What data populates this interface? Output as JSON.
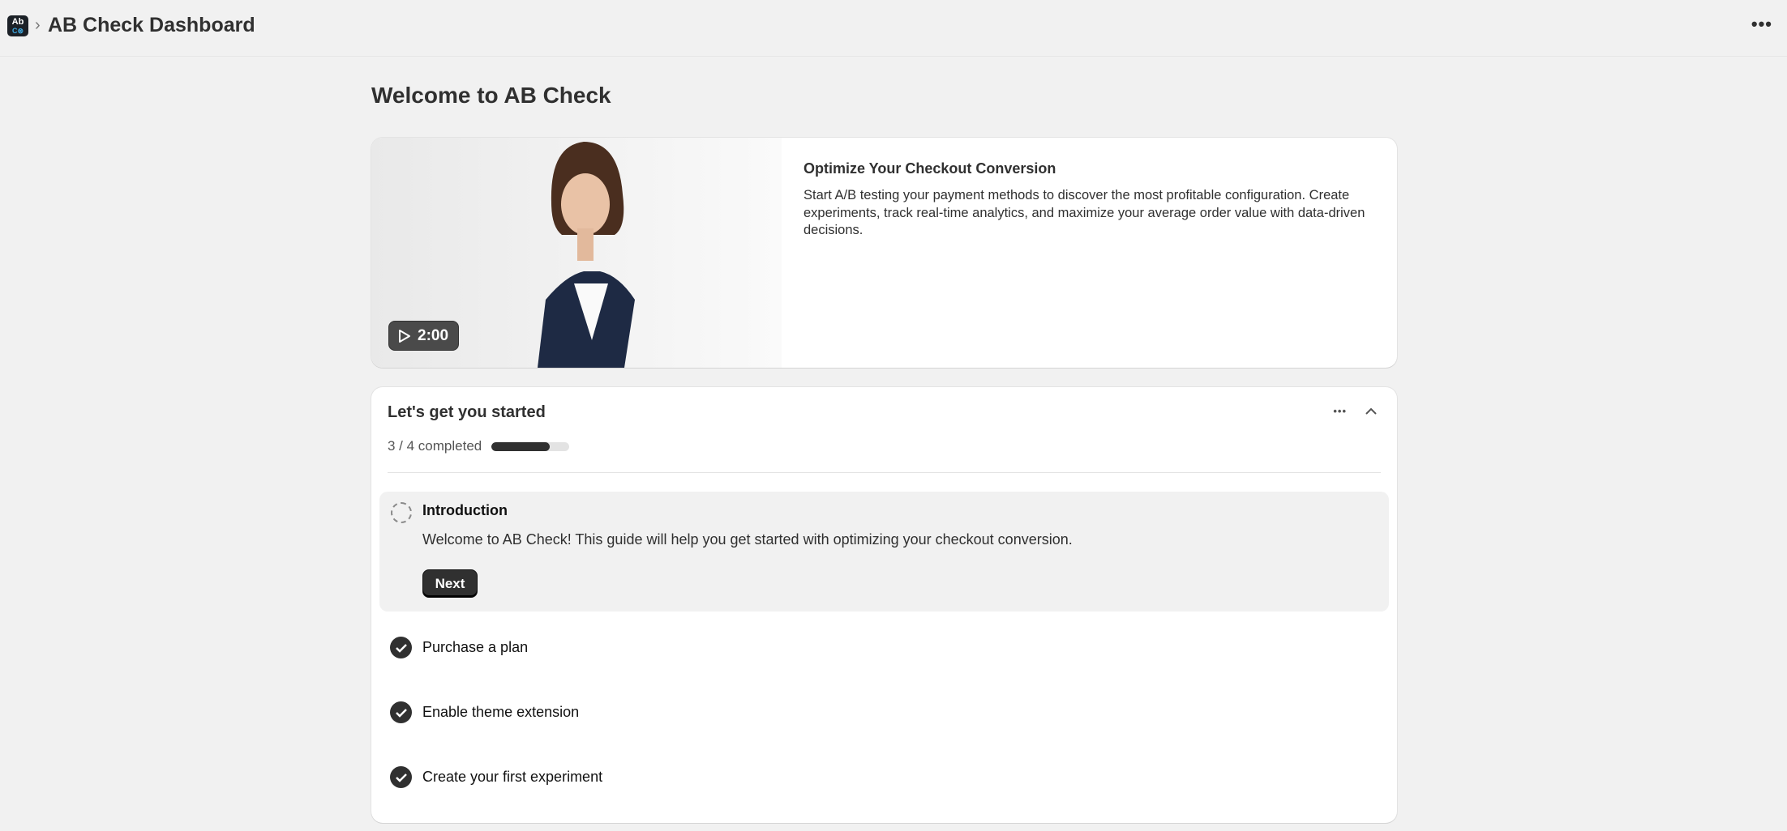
{
  "header": {
    "app_icon_text": "Ab",
    "app_icon_sub": "C⊗",
    "separator": "›",
    "title": "AB Check Dashboard",
    "more": "•••"
  },
  "page_title": "Welcome to AB Check",
  "hero": {
    "video_duration": "2:00",
    "heading": "Optimize Your Checkout Conversion",
    "description": "Start A/B testing your payment methods to discover the most profitable configuration. Create experiments, track real-time analytics, and maximize your average order value with data-driven decisions."
  },
  "setup": {
    "title": "Let's get you started",
    "more": "•••",
    "collapse": "⌃",
    "progress_text": "3 / 4 completed",
    "progress_percent": 75,
    "intro": {
      "title": "Introduction",
      "description": "Welcome to AB Check! This guide will help you get started with optimizing your checkout conversion.",
      "next_label": "Next"
    },
    "tasks": [
      {
        "label": "Purchase a plan"
      },
      {
        "label": "Enable theme extension"
      },
      {
        "label": "Create your first experiment"
      }
    ]
  }
}
